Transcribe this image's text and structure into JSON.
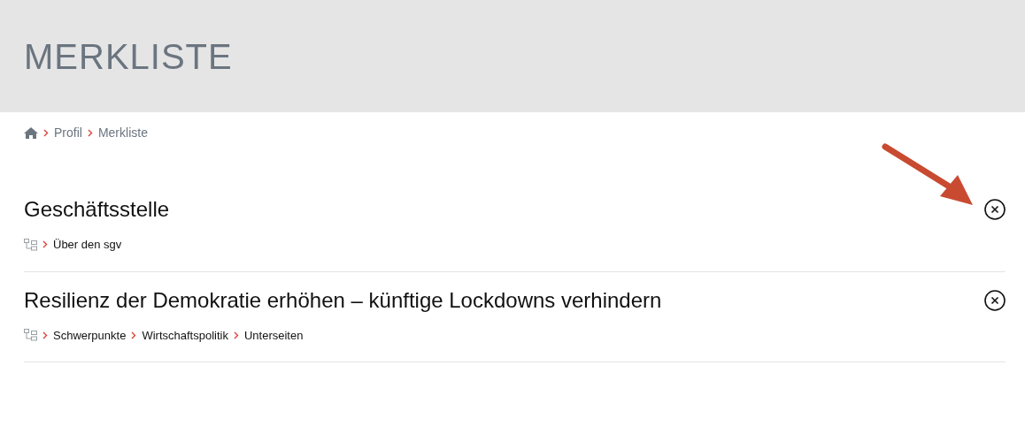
{
  "header": {
    "title": "MERKLISTE"
  },
  "breadcrumb": [
    "Profil",
    "Merkliste"
  ],
  "items": [
    {
      "title": "Geschäftsstelle",
      "path": [
        "Über den sgv"
      ]
    },
    {
      "title": "Resilienz der Demokratie erhöhen – künftige Lockdowns verhindern",
      "path": [
        "Schwerpunkte",
        "Wirtschaftspolitik",
        "Unterseiten"
      ]
    }
  ]
}
